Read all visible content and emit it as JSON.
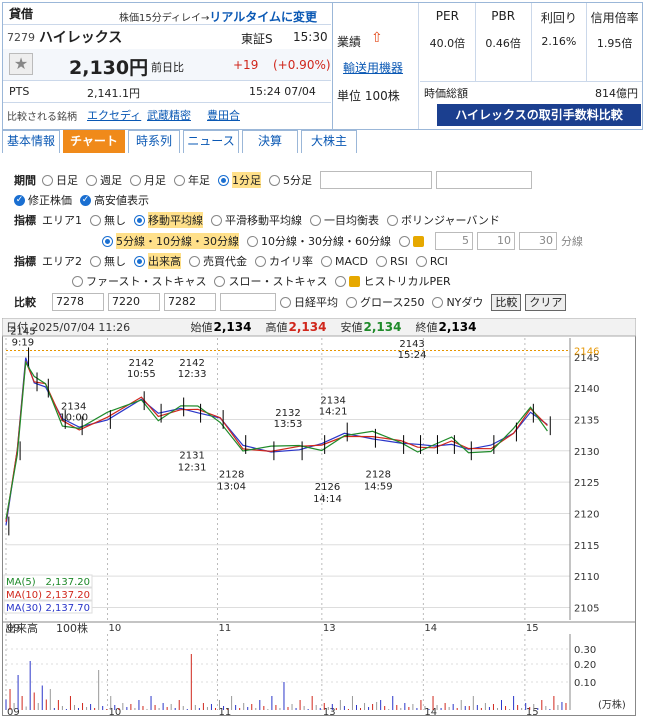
{
  "header": {
    "tag": "貸借",
    "delay_text": "株価15分ディレイ→",
    "realtime_link": "リアルタイムに変更",
    "code": "7279",
    "name": "ハイレックス",
    "market": "東証S",
    "time": "15:30",
    "star": "★",
    "price": "2,130円",
    "prev_label": "前日比",
    "change": "+19",
    "change_pct": "(+0.90%)",
    "pts_label": "PTS",
    "pts_price": "2,141.1円",
    "pts_time": "15:24 07/04",
    "compare_label": "比較される銘柄",
    "compare": [
      "エクセディ",
      "武蔵精密",
      "豊田合"
    ]
  },
  "business": {
    "label": "業績",
    "arrow": "⇧",
    "sector": "輸送用機器",
    "unit": "単位 100株"
  },
  "metrics": [
    {
      "h": "PER",
      "v": "40.0倍"
    },
    {
      "h": "PBR",
      "v": "0.46倍"
    },
    {
      "h": "利回り",
      "v": "2.16%"
    },
    {
      "h": "信用倍率",
      "v": "1.95倍"
    }
  ],
  "market_cap": {
    "label": "時価総額",
    "value": "814億円"
  },
  "ad": "ハイレックスの取引手数料比較",
  "tabs": [
    "基本情報",
    "チャート",
    "時系列",
    "ニュース",
    "決算",
    "大株主"
  ],
  "period": {
    "label": "期間",
    "options": [
      "日足",
      "週足",
      "月足",
      "年足",
      "1分足",
      "5分足"
    ],
    "selected": "1分足"
  },
  "adjust": {
    "opt1": "修正株価",
    "opt2": "高安値表示"
  },
  "ind1": {
    "label": "指標",
    "area": "エリア1",
    "options": [
      "無し",
      "移動平均線",
      "平滑移動平均線",
      "一目均衡表",
      "ボリンジャーバンド"
    ],
    "selected": "移動平均線",
    "sub": [
      "5分線・10分線・30分線",
      "10分線・30分線・60分線"
    ],
    "inputs": [
      "5",
      "10",
      "30"
    ],
    "unit": "分線"
  },
  "ind2": {
    "label": "指標",
    "area": "エリア2",
    "options": [
      "無し",
      "出来高",
      "売買代金",
      "カイリ率",
      "MACD",
      "RSI",
      "RCI"
    ],
    "selected": "出来高",
    "options2": [
      "ファースト・ストキャス",
      "スロー・ストキャス",
      "ヒストリカルPER"
    ]
  },
  "compare_ctrl": {
    "label": "比較",
    "inputs": [
      "7278",
      "7220",
      "7282",
      ""
    ],
    "checks": [
      "日経平均",
      "グロース250",
      "NYダウ"
    ],
    "btn1": "比較",
    "btn2": "クリア"
  },
  "chart_data": {
    "type": "line",
    "header": {
      "date_label": "日付",
      "date": "2025/07/04 11:26",
      "open_label": "始値",
      "open": "2,134",
      "high_label": "高値",
      "high": "2,134",
      "low_label": "安値",
      "low": "2,134",
      "close_label": "終値",
      "close": "2,134"
    },
    "x_ticks": [
      "09",
      "10",
      "11",
      "13",
      "14",
      "15"
    ],
    "y_ticks": [
      2105,
      2110,
      2115,
      2120,
      2125,
      2130,
      2135,
      2140,
      2145
    ],
    "ylim": [
      2103,
      2148
    ],
    "current": 2146,
    "annotations": [
      {
        "t": "9:19",
        "v": "2145",
        "x": 0.03,
        "y": 2146
      },
      {
        "t": "10:00",
        "v": "2134",
        "x": 0.12,
        "y": 2134
      },
      {
        "t": "10:55",
        "v": "2142",
        "x": 0.24,
        "y": 2141
      },
      {
        "t": "12:33",
        "v": "2142",
        "x": 0.33,
        "y": 2141
      },
      {
        "t": "12:31",
        "v": "2131",
        "x": 0.33,
        "y": 2131
      },
      {
        "t": "13:04",
        "v": "2128",
        "x": 0.4,
        "y": 2128
      },
      {
        "t": "13:53",
        "v": "2132",
        "x": 0.5,
        "y": 2133
      },
      {
        "t": "14:21",
        "v": "2134",
        "x": 0.58,
        "y": 2135
      },
      {
        "t": "14:14",
        "v": "2126",
        "x": 0.57,
        "y": 2126
      },
      {
        "t": "14:59",
        "v": "2128",
        "x": 0.66,
        "y": 2128
      },
      {
        "t": "15:24",
        "v": "2143",
        "x": 0.72,
        "y": 2144
      }
    ],
    "ma": [
      {
        "name": "MA(5)",
        "value": "2,137.20",
        "color": "#1f8a2a"
      },
      {
        "name": "MA(10)",
        "value": "2,137.20",
        "color": "#d0271c"
      },
      {
        "name": "MA(30)",
        "value": "2,137.70",
        "color": "#2b36c9"
      }
    ],
    "volume_label": "出来高",
    "volume_unit": "100株",
    "vol_ticks": [
      "0.30",
      "0.20",
      "0.10"
    ],
    "vol_unit2": "(万株)",
    "colors": {
      "ma5": "#1f8a2a",
      "ma10": "#d0271c",
      "ma30": "#2b36c9",
      "price": "#000000",
      "vol_up": "#d0271c",
      "vol_dn": "#2b36c9"
    }
  }
}
